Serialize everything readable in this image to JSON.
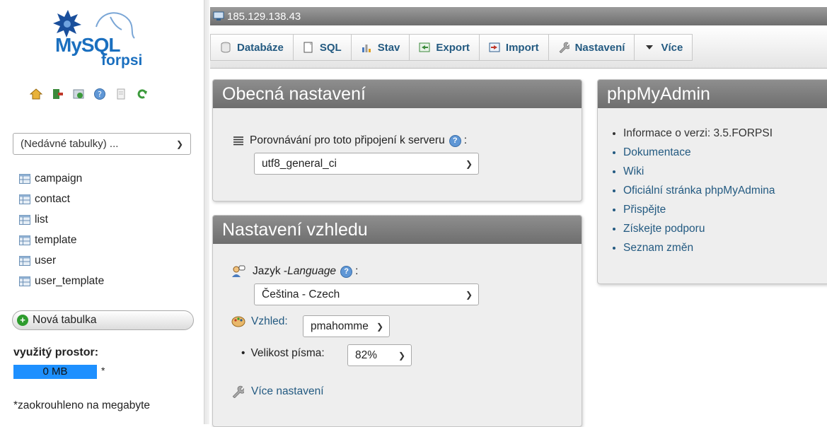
{
  "server": {
    "address": "185.129.138.43"
  },
  "logo": {
    "mysql": "MySQL",
    "forpsi": "forpsi"
  },
  "sidebar": {
    "recent_tables": "(Nedávné tabulky) ...",
    "tables": [
      "campaign",
      "contact",
      "list",
      "template",
      "user",
      "user_template"
    ],
    "new_table": "Nová tabulka",
    "space_label": "využitý prostor:",
    "space_value": "0 MB",
    "space_star": "*",
    "rounded_note": "*zaokrouhleno na megabyte"
  },
  "menu": {
    "tabs": [
      {
        "label": "Databáze",
        "icon": "database-icon"
      },
      {
        "label": "SQL",
        "icon": "sql-icon"
      },
      {
        "label": "Stav",
        "icon": "status-icon"
      },
      {
        "label": "Export",
        "icon": "export-icon"
      },
      {
        "label": "Import",
        "icon": "import-icon"
      },
      {
        "label": "Nastavení",
        "icon": "wrench-icon"
      },
      {
        "label": "Více",
        "icon": "triangle-down-icon"
      }
    ]
  },
  "general": {
    "title": "Obecná nastavení",
    "collation_label": "Porovnávání pro toto připojení k serveru",
    "colon": ":",
    "collation_value": "utf8_general_ci"
  },
  "appearance": {
    "title": "Nastavení vzhledu",
    "language_label": "Jazyk - ",
    "language_italic": "Language",
    "language_value": "Čeština - Czech",
    "theme_label": "Vzhled:",
    "theme_value": "pmahomme",
    "font_size_label": "Velikost písma:",
    "font_size_value": "82%",
    "more_settings": "Více nastavení"
  },
  "pma": {
    "title": "phpMyAdmin",
    "version_text": "Informace o verzi: 3.5.FORPSI",
    "links": [
      "Dokumentace",
      "Wiki",
      "Oficiální stránka phpMyAdmina",
      "Přispějte",
      "Získejte podporu",
      "Seznam změn"
    ]
  },
  "colors": {
    "link": "#235a81",
    "header_gray": "#7a7a7a",
    "usage_bar": "#1e90ff",
    "accent_green": "#2e9c2e"
  }
}
